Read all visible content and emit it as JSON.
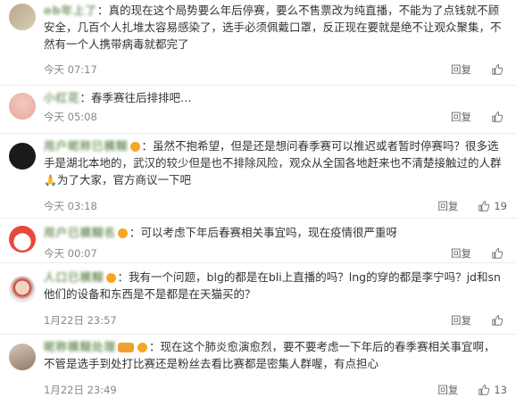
{
  "comments": [
    {
      "username": "ob年上了",
      "text": "真的现在这个局势要么年后停赛，要么不售票改为纯直播，不能为了点钱就不顾安全，几百个人扎堆太容易感染了，选手必须佩戴口罩，反正现在要就是绝不让观众聚集，不然有一个人携带病毒就都完了",
      "time": "今天 07:17",
      "reply": "回复",
      "likes": ""
    },
    {
      "username": "小红花",
      "text": "春季赛往后排排吧…",
      "time": "今天 05:08",
      "reply": "回复",
      "likes": ""
    },
    {
      "username": "用户昵称已模糊",
      "text": "虽然不抱希望，但是还是想问春季赛可以推迟或者暂时停赛吗？很多选手是湖北本地的，武汉的较少但是也不排除风险，观众从全国各地赶来也不清楚接触过的人群",
      "text_after": "为了大家，官方商议一下吧",
      "time": "今天 03:18",
      "reply": "回复",
      "likes": "19"
    },
    {
      "username": "用户已模糊名",
      "text": "可以考虑下年后春赛相关事宜吗，现在疫情很严重呀",
      "time": "今天 00:07",
      "reply": "回复",
      "likes": ""
    },
    {
      "username": "人口已模糊",
      "text": "我有一个问题，blg的都是在bli上直播的吗？lng的穿的都是李宁吗？jd和sn他们的设备和东西是不是都是在天猫买的？",
      "time": "1月22日 23:57",
      "reply": "回复",
      "likes": ""
    },
    {
      "username": "昵称模糊处理",
      "text": "现在这个肺炎愈演愈烈，要不要考虑一下年后的春季赛相关事宜啊，不管是选手到处打比赛还是粉丝去看比赛都是密集人群喔，有点担心",
      "time": "1月22日 23:49",
      "reply": "回复",
      "likes": "13"
    }
  ]
}
